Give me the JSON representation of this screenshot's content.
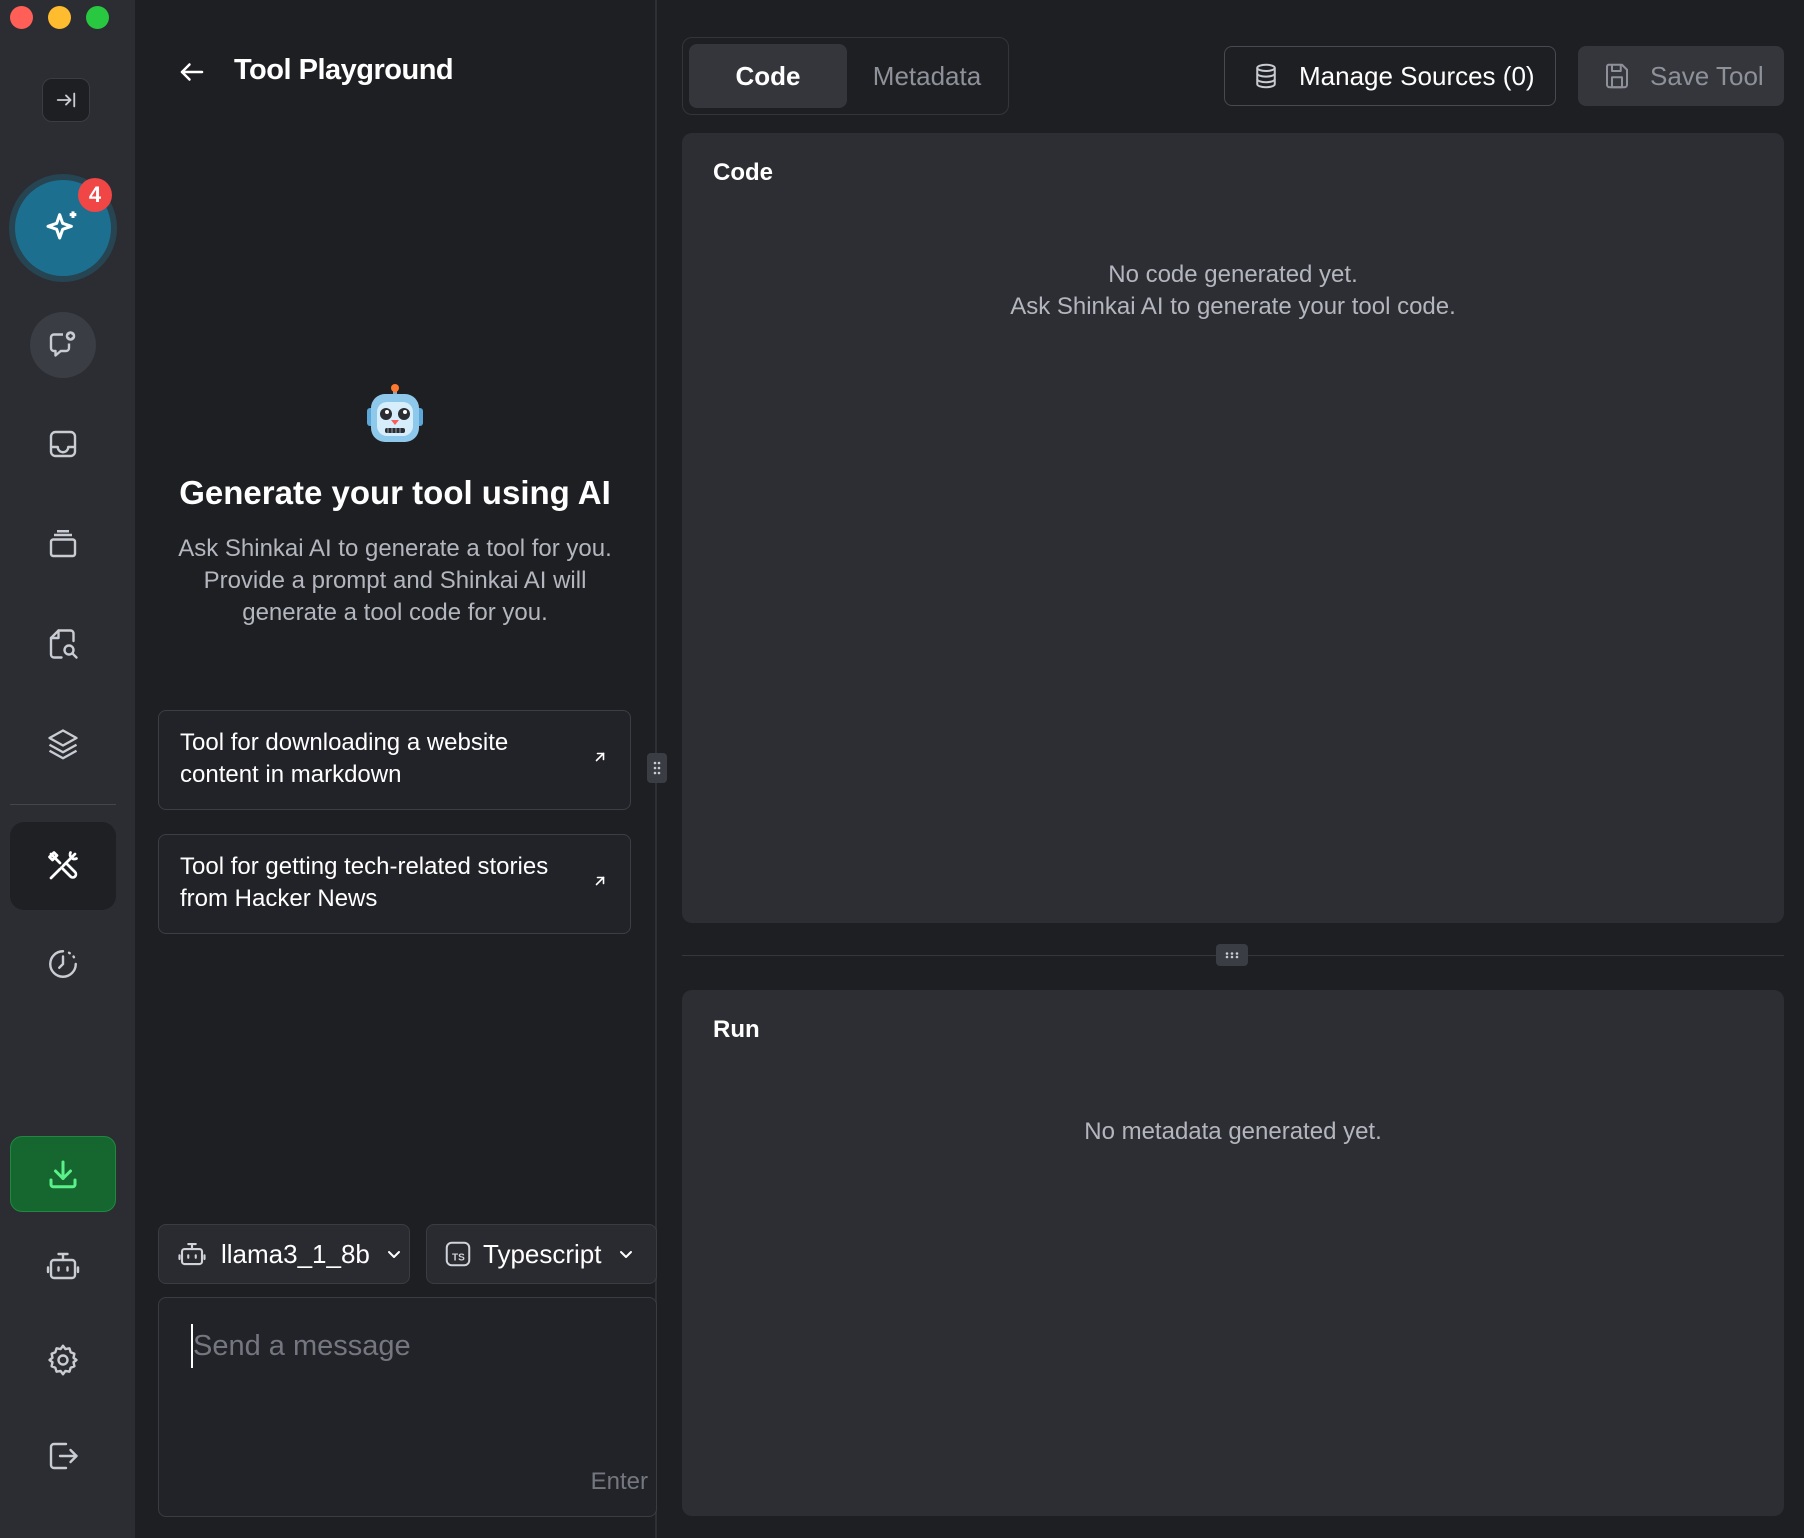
{
  "page": {
    "title": "Tool Playground"
  },
  "sidebar": {
    "ai_badge_count": "4"
  },
  "empty_state": {
    "title": "Generate your tool using AI",
    "description": "Ask Shinkai AI to generate a tool for you. Provide a prompt and Shinkai AI will generate a tool code for you."
  },
  "suggestions": [
    {
      "label": "Tool for downloading a website content in markdown"
    },
    {
      "label": "Tool for getting tech-related stories from Hacker News"
    }
  ],
  "composer": {
    "model": "llama3_1_8b",
    "language": "Typescript",
    "placeholder": "Send a message",
    "enter_hint": "Enter"
  },
  "tabs": [
    {
      "label": "Code",
      "active": true
    },
    {
      "label": "Metadata",
      "active": false
    }
  ],
  "toolbar": {
    "manage_sources": "Manage Sources (0)",
    "save_tool": "Save Tool"
  },
  "code_panel": {
    "title": "Code",
    "empty_line1": "No code generated yet.",
    "empty_line2": "Ask Shinkai AI to generate your tool code."
  },
  "run_panel": {
    "title": "Run",
    "empty": "No metadata generated yet."
  },
  "colors": {
    "background": "#1e1f23",
    "sidebar": "#2b2d32",
    "card": "#2d2e33",
    "accent_ai": "#1d6f8f",
    "badge": "#f04646",
    "download": "#16672f"
  }
}
